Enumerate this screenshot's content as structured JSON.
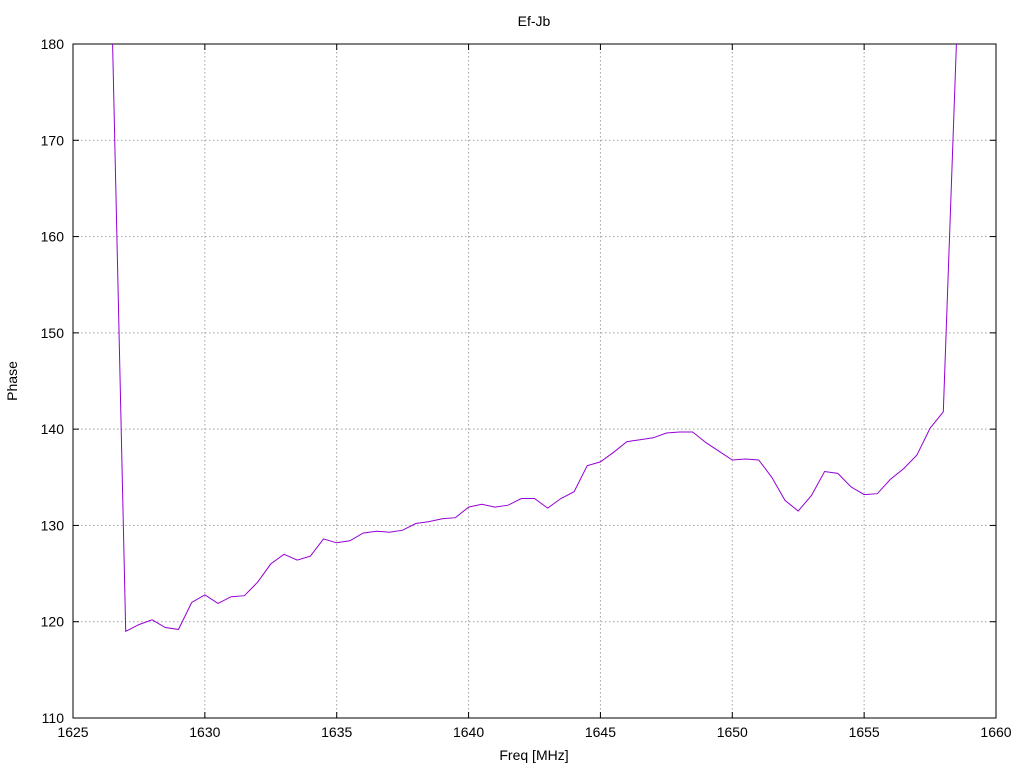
{
  "chart_data": {
    "type": "line",
    "title": "Ef-Jb",
    "xlabel": "Freq [MHz]",
    "ylabel": "Phase",
    "xlim": [
      1625,
      1660
    ],
    "ylim": [
      110,
      180
    ],
    "xticks": [
      1625,
      1630,
      1635,
      1640,
      1645,
      1650,
      1655,
      1660
    ],
    "yticks": [
      110,
      120,
      130,
      140,
      150,
      160,
      170,
      180
    ],
    "grid": true,
    "legend": false,
    "colors": {
      "series": "#9400d3"
    },
    "series": [
      {
        "x": [
          1626.5,
          1627.0,
          1627.5,
          1628.0,
          1628.5,
          1629.0,
          1629.5,
          1630.0,
          1630.5,
          1631.0,
          1631.5,
          1632.0,
          1632.5,
          1633.0,
          1633.5,
          1634.0,
          1634.5,
          1635.0,
          1635.5,
          1636.0,
          1636.5,
          1637.0,
          1637.5,
          1638.0,
          1638.5,
          1639.0,
          1639.5,
          1640.0,
          1640.5,
          1641.0,
          1641.5,
          1642.0,
          1642.5,
          1643.0,
          1643.5,
          1644.0,
          1644.5,
          1645.0,
          1645.5,
          1646.0,
          1646.5,
          1647.0,
          1647.5,
          1648.0,
          1648.5,
          1649.0,
          1649.5,
          1650.0,
          1650.5,
          1651.0,
          1651.5,
          1652.0,
          1652.5,
          1653.0,
          1653.5,
          1654.0,
          1654.5,
          1655.0,
          1655.5,
          1656.0,
          1656.5,
          1657.0,
          1657.5,
          1658.0,
          1658.5
        ],
        "y": [
          180.0,
          119.0,
          119.7,
          120.2,
          119.4,
          119.2,
          122.0,
          122.8,
          121.9,
          122.6,
          122.7,
          124.1,
          126.0,
          127.0,
          126.4,
          126.8,
          128.6,
          128.2,
          128.4,
          129.2,
          129.4,
          129.3,
          129.5,
          130.2,
          130.4,
          130.7,
          130.8,
          131.9,
          132.2,
          131.9,
          132.1,
          132.8,
          132.8,
          131.8,
          132.8,
          133.5,
          136.2,
          136.6,
          137.6,
          138.7,
          138.9,
          139.1,
          139.6,
          139.7,
          139.7,
          138.6,
          137.7,
          136.8,
          136.9,
          136.8,
          135.0,
          132.6,
          131.5,
          133.1,
          135.6,
          135.4,
          134.0,
          133.2,
          133.3,
          134.8,
          135.9,
          137.3,
          140.1,
          141.8,
          180.0
        ]
      }
    ]
  }
}
